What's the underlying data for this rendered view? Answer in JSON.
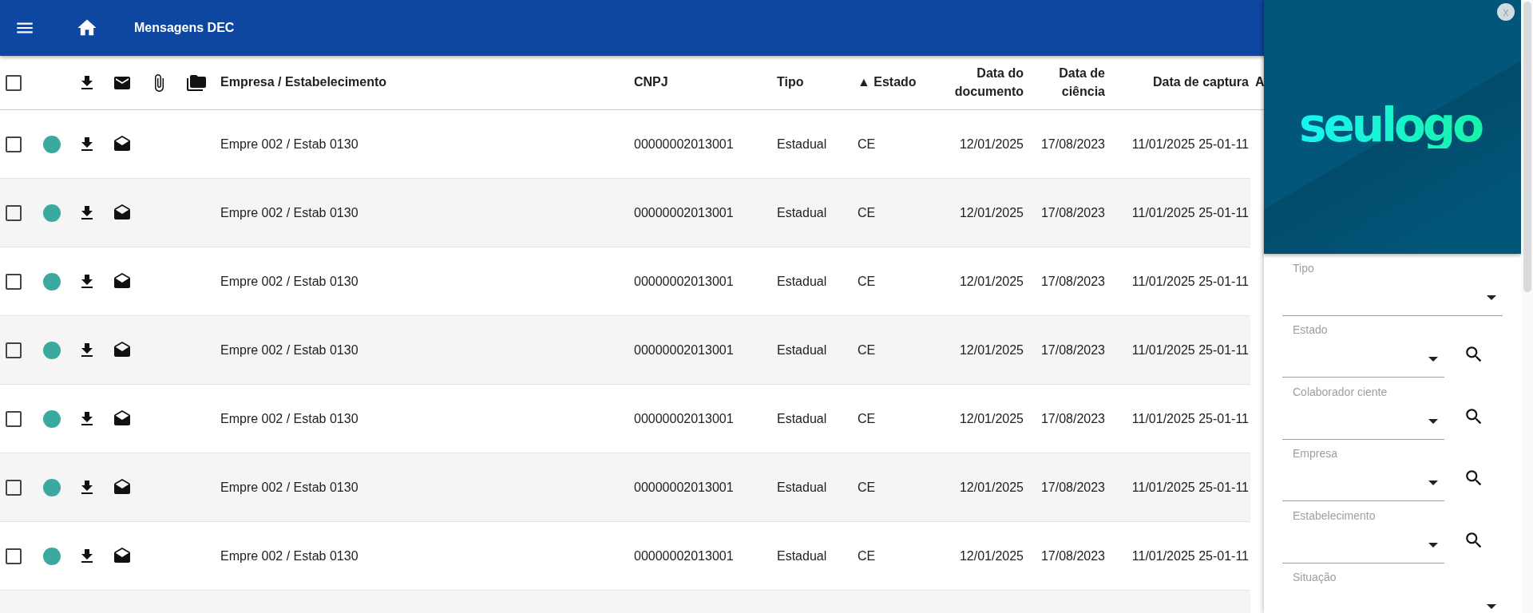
{
  "app_bar": {
    "title": "Mensagens DEC"
  },
  "table": {
    "select_all": {
      "checked": false
    },
    "columns": [
      {
        "label": "Empresa / Estabelecimento"
      },
      {
        "label": "CNPJ"
      },
      {
        "label": "Tipo"
      },
      {
        "label": "Estado",
        "sort_mark": "▲"
      },
      {
        "label": "Data do documento"
      },
      {
        "label": "Data de ciência"
      },
      {
        "label": "Data de captura"
      },
      {
        "label": "A"
      }
    ],
    "rows": [
      {
        "checked": false,
        "color": "#3aa99f",
        "opened": true,
        "cells": [
          "Empre 002 / Estab 0130",
          "00000002013001",
          "Estadual",
          "CE",
          "12/01/2025",
          "17/08/2023",
          "11/01/2025 25-01-11"
        ]
      },
      {
        "checked": false,
        "color": "#3aa99f",
        "opened": true,
        "cells": [
          "Empre 002 / Estab 0130",
          "00000002013001",
          "Estadual",
          "CE",
          "12/01/2025",
          "17/08/2023",
          "11/01/2025 25-01-11"
        ]
      },
      {
        "checked": false,
        "color": "#3aa99f",
        "opened": true,
        "cells": [
          "Empre 002 / Estab 0130",
          "00000002013001",
          "Estadual",
          "CE",
          "12/01/2025",
          "17/08/2023",
          "11/01/2025 25-01-11"
        ]
      },
      {
        "checked": false,
        "color": "#3aa99f",
        "opened": true,
        "cells": [
          "Empre 002 / Estab 0130",
          "00000002013001",
          "Estadual",
          "CE",
          "12/01/2025",
          "17/08/2023",
          "11/01/2025 25-01-11"
        ]
      },
      {
        "checked": false,
        "color": "#3aa99f",
        "opened": true,
        "cells": [
          "Empre 002 / Estab 0130",
          "00000002013001",
          "Estadual",
          "CE",
          "12/01/2025",
          "17/08/2023",
          "11/01/2025 25-01-11"
        ]
      },
      {
        "checked": false,
        "color": "#3aa99f",
        "opened": true,
        "cells": [
          "Empre 002 / Estab 0130",
          "00000002013001",
          "Estadual",
          "CE",
          "12/01/2025",
          "17/08/2023",
          "11/01/2025 25-01-11"
        ]
      },
      {
        "checked": false,
        "color": "#3aa99f",
        "opened": true,
        "cells": [
          "Empre 002 / Estab 0130",
          "00000002013001",
          "Estadual",
          "CE",
          "12/01/2025",
          "17/08/2023",
          "11/01/2025 25-01-11"
        ]
      }
    ]
  },
  "filter_panel": {
    "logo": "seulogo",
    "close_label": "x",
    "fields": [
      {
        "label": "Tipo",
        "kind": "select"
      },
      {
        "label": "Estado",
        "kind": "select_search"
      },
      {
        "label": "Colaborador ciente",
        "kind": "select_search"
      },
      {
        "label": "Empresa",
        "kind": "select_search"
      },
      {
        "label": "Estabelecimento",
        "kind": "select_search"
      },
      {
        "label": "Situação",
        "kind": "select"
      }
    ]
  }
}
